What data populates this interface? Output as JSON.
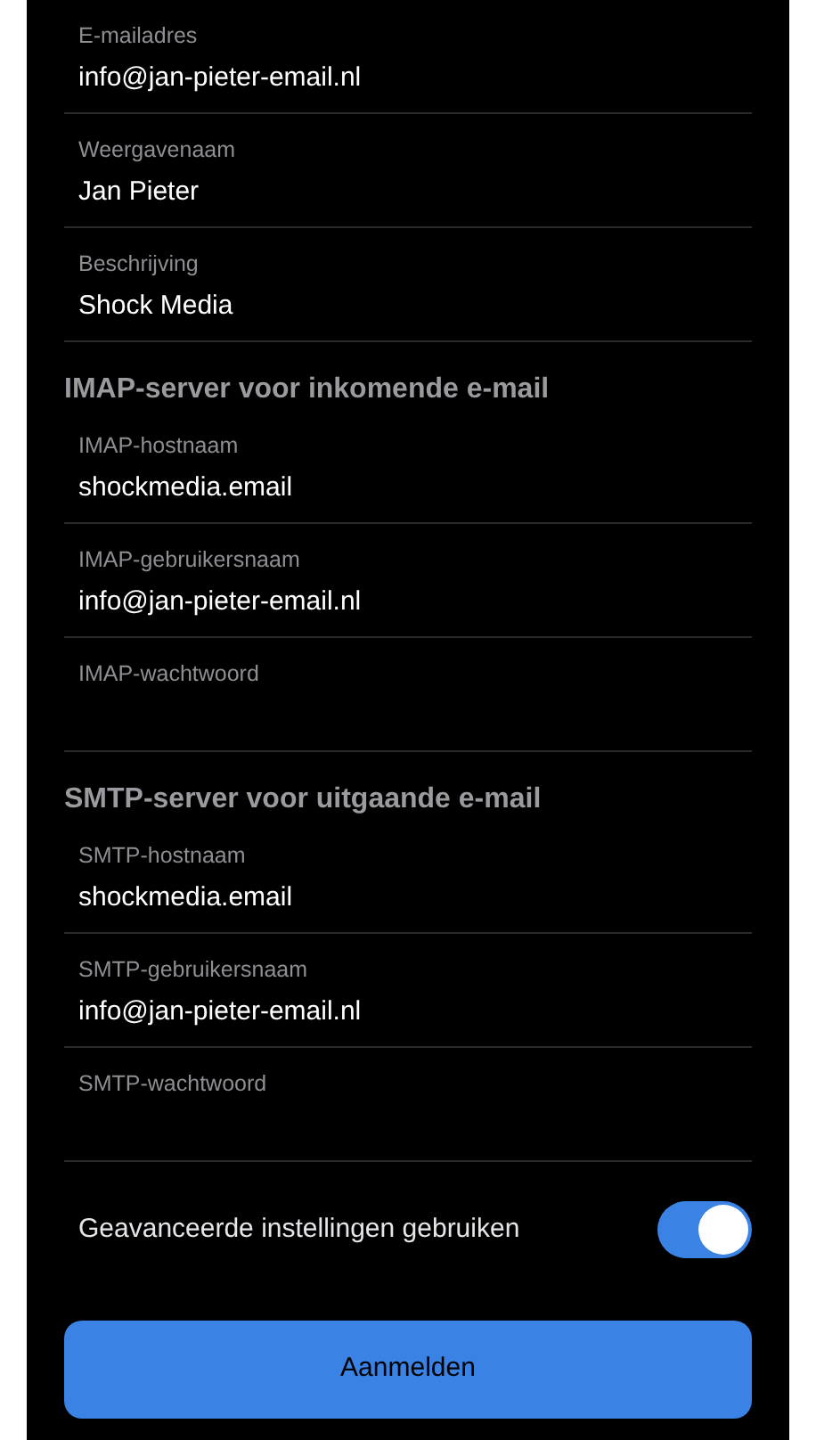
{
  "account_fields": [
    {
      "label": "E-mailadres",
      "value": "info@jan-pieter-email.nl"
    },
    {
      "label": "Weergavenaam",
      "value": "Jan Pieter"
    },
    {
      "label": "Beschrijving",
      "value": "Shock Media"
    }
  ],
  "sections": [
    {
      "heading": "IMAP-server voor inkomende e-mail",
      "fields": [
        {
          "label": "IMAP-hostnaam",
          "value": "shockmedia.email"
        },
        {
          "label": "IMAP-gebruikersnaam",
          "value": "info@jan-pieter-email.nl"
        },
        {
          "label": "IMAP-wachtwoord"
        }
      ]
    },
    {
      "heading": "SMTP-server voor uitgaande e-mail",
      "fields": [
        {
          "label": "SMTP-hostnaam",
          "value": "shockmedia.email"
        },
        {
          "label": "SMTP-gebruikersnaam",
          "value": "info@jan-pieter-email.nl"
        },
        {
          "label": "SMTP-wachtwoord"
        }
      ]
    }
  ],
  "advanced_toggle": {
    "label": "Geavanceerde instellingen gebruiken",
    "on": true
  },
  "submit_button": "Aanmelden"
}
